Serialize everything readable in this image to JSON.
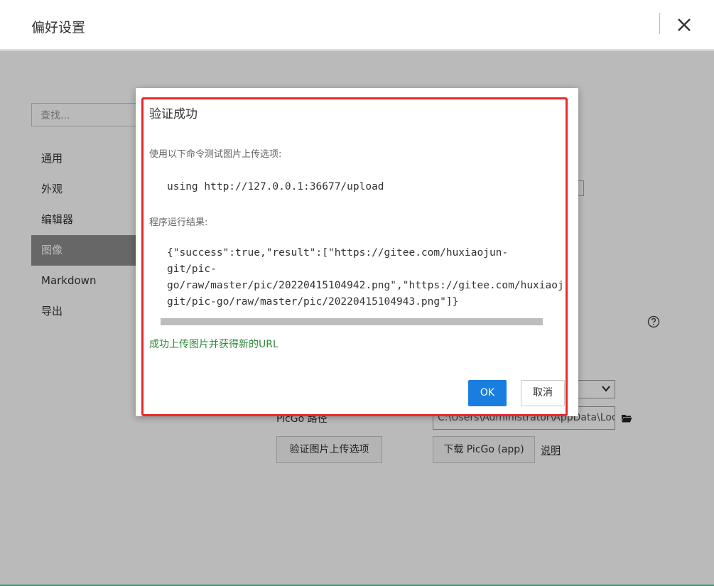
{
  "window": {
    "title": "偏好设置"
  },
  "sidebar": {
    "search_placeholder": "查找...",
    "items": [
      {
        "label": "通用",
        "active": false
      },
      {
        "label": "外观",
        "active": false
      },
      {
        "label": "编辑器",
        "active": false
      },
      {
        "label": "图像",
        "active": true
      },
      {
        "label": "Markdown",
        "active": false
      },
      {
        "label": "导出",
        "active": false
      }
    ]
  },
  "settings": {
    "picgo_path_label": "PicGo 路径",
    "picgo_path_value": "C:\\Users\\Administrator\\AppData\\Local",
    "verify_button": "验证图片上传选项",
    "download_button": "下载 PicGo (app)",
    "help_link": "说明"
  },
  "dialog": {
    "title": "验证成功",
    "command_label": "使用以下命令测试图片上传选项:",
    "command": "using http://127.0.0.1:36677/upload",
    "result_label": "程序运行结果:",
    "result_lines": [
      "{\"success\":true,\"result\":[\"https://gitee.com/huxiaojun-",
      "git/pic-",
      "go/raw/master/pic/20220415104942.png\",\"https://gitee.com/huxiaoj",
      "git/pic-go/raw/master/pic/20220415104943.png\"]}"
    ],
    "success_message": "成功上传图片并获得新的URL",
    "ok_button": "OK",
    "cancel_button": "取消"
  },
  "colors": {
    "accent": "#1a7de0",
    "success": "#2e8b3a",
    "highlight_border": "#f0262a"
  }
}
